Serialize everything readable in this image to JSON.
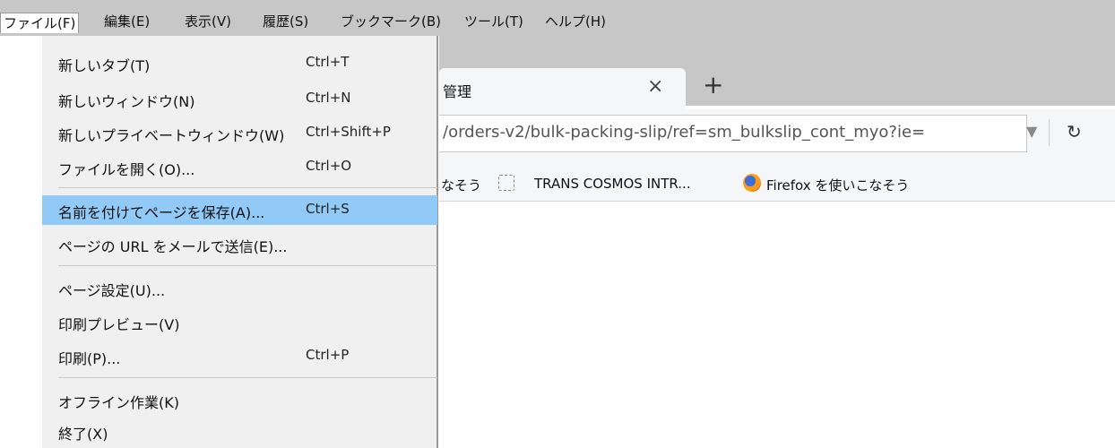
{
  "menubar": {
    "items": [
      {
        "label": "ファイル(F)"
      },
      {
        "label": "編集(E)"
      },
      {
        "label": "表示(V)"
      },
      {
        "label": "履歴(S)"
      },
      {
        "label": "ブックマーク(B)"
      },
      {
        "label": "ツール(T)"
      },
      {
        "label": "ヘルプ(H)"
      }
    ]
  },
  "tab": {
    "title": "管理",
    "close_glyph": "×",
    "new_tab_glyph": "+"
  },
  "urlbar": {
    "url": "/orders-v2/bulk-packing-slip/ref=sm_bulkslip_cont_myo?ie=",
    "dropdown_glyph": "▼",
    "reload_glyph": "↻"
  },
  "bookmarks": {
    "items": [
      {
        "label": "なそう"
      },
      {
        "label": "TRANS COSMOS INTR..."
      },
      {
        "label": "Firefox を使いこなそう"
      }
    ]
  },
  "file_menu": {
    "items": [
      {
        "label": "新しいタブ(T)",
        "shortcut": "Ctrl+T"
      },
      {
        "label": "新しいウィンドウ(N)",
        "shortcut": "Ctrl+N"
      },
      {
        "label": "新しいプライベートウィンドウ(W)",
        "shortcut": "Ctrl+Shift+P"
      },
      {
        "label": "ファイルを開く(O)...",
        "shortcut": "Ctrl+O"
      },
      {
        "label": "名前を付けてページを保存(A)...",
        "shortcut": "Ctrl+S",
        "highlighted": true
      },
      {
        "label": "ページの URL をメールで送信(E)...",
        "shortcut": ""
      },
      {
        "label": "ページ設定(U)...",
        "shortcut": ""
      },
      {
        "label": "印刷プレビュー(V)",
        "shortcut": ""
      },
      {
        "label": "印刷(P)...",
        "shortcut": "Ctrl+P"
      },
      {
        "label": "オフライン作業(K)",
        "shortcut": ""
      },
      {
        "label": "終了(X)",
        "shortcut": ""
      }
    ]
  },
  "colors": {
    "menubar_bg": "#c7c7c7",
    "menu_bg": "#f0f0f0",
    "highlight": "#91c9f7"
  }
}
